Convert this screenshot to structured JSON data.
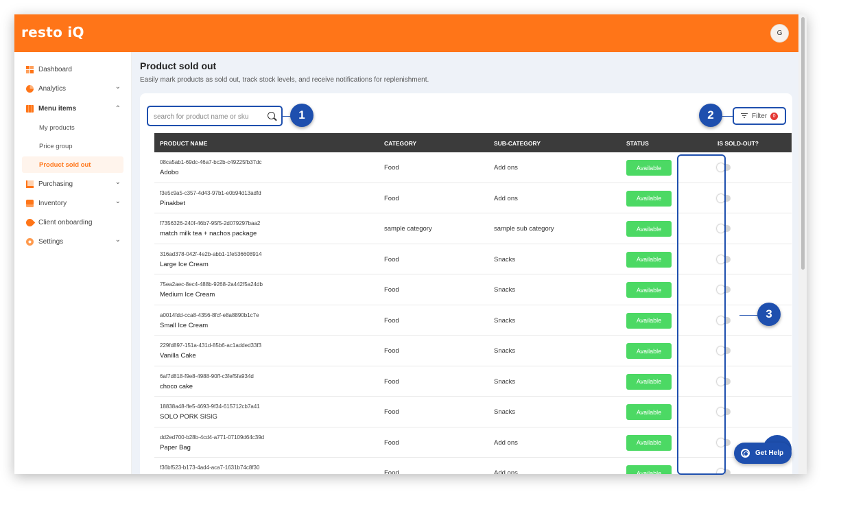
{
  "app": {
    "brand": "resto iQ",
    "avatar_initial": "G",
    "accent_color": "#ff7518",
    "annotation_color": "#1e4fae"
  },
  "sidebar": {
    "items": [
      {
        "label": "Dashboard",
        "icon": "dashboard-icon",
        "chevron": ""
      },
      {
        "label": "Analytics",
        "icon": "pie-chart-icon",
        "chevron": "⌄"
      },
      {
        "label": "Menu items",
        "icon": "menu-icon",
        "chevron": "⌃"
      },
      {
        "label": "Purchasing",
        "icon": "cart-icon",
        "chevron": "⌄"
      },
      {
        "label": "Inventory",
        "icon": "box-icon",
        "chevron": "⌄"
      },
      {
        "label": "Client onboarding",
        "icon": "rocket-icon",
        "chevron": ""
      },
      {
        "label": "Settings",
        "icon": "gear-icon",
        "chevron": "⌄"
      }
    ],
    "submenu": [
      {
        "label": "My products"
      },
      {
        "label": "Price group"
      },
      {
        "label": "Product sold out"
      }
    ]
  },
  "page": {
    "title": "Product sold out",
    "subtitle": "Easily mark products as sold out, track stock levels, and receive notifications for replenishment."
  },
  "search": {
    "placeholder": "search for product name or sku",
    "value": ""
  },
  "filter": {
    "label": "Filter",
    "count": "0"
  },
  "callouts": [
    "1",
    "2",
    "3"
  ],
  "table": {
    "headers": [
      "PRODUCT NAME",
      "CATEGORY",
      "SUB-CATEGORY",
      "STATUS",
      "IS SOLD-OUT?"
    ],
    "rows": [
      {
        "id": "08ca5ab1-69dc-46a7-bc2b-c49225fb37dc",
        "name": "Adobo",
        "category": "Food",
        "sub": "Add ons",
        "status": "Available"
      },
      {
        "id": "f3e5c9a5-c357-4d43-97b1-e0b94d13adfd",
        "name": "Pinakbet",
        "category": "Food",
        "sub": "Add ons",
        "status": "Available"
      },
      {
        "id": "f7356326-240f-46b7-95f5-2d079297baa2",
        "name": "match milk tea + nachos package",
        "category": "sample category",
        "sub": "sample sub category",
        "status": "Available"
      },
      {
        "id": "316ad378-042f-4e2b-abb1-1fe536608914",
        "name": "Large Ice Cream",
        "category": "Food",
        "sub": "Snacks",
        "status": "Available"
      },
      {
        "id": "75ea2aec-8ec4-488b-9268-2a442f5a24db",
        "name": "Medium Ice Cream",
        "category": "Food",
        "sub": "Snacks",
        "status": "Available"
      },
      {
        "id": "a0014fdd-cca8-4356-8fcf-e8a8890b1c7e",
        "name": "Small Ice Cream",
        "category": "Food",
        "sub": "Snacks",
        "status": "Available"
      },
      {
        "id": "229fd897-151a-431d-85b6-ac1added33f3",
        "name": "Vanilla Cake",
        "category": "Food",
        "sub": "Snacks",
        "status": "Available"
      },
      {
        "id": "6af7d818-f9e8-4988-90ff-c3fef5fa934d",
        "name": "choco cake",
        "category": "Food",
        "sub": "Snacks",
        "status": "Available"
      },
      {
        "id": "18838a48-ffe5-4693-9f34-615712cb7a41",
        "name": "SOLO PORK SISIG",
        "category": "Food",
        "sub": "Snacks",
        "status": "Available"
      },
      {
        "id": "dd2ed700-b28b-4cd4-a771-07109d64c39d",
        "name": "Paper Bag",
        "category": "Food",
        "sub": "Add ons",
        "status": "Available"
      },
      {
        "id": "f36bf523-b173-4ad4-aca7-1631b74c8f30",
        "name": "",
        "category": "Food",
        "sub": "Add ons",
        "status": "Available"
      }
    ]
  },
  "help": {
    "label": "Get Help"
  }
}
